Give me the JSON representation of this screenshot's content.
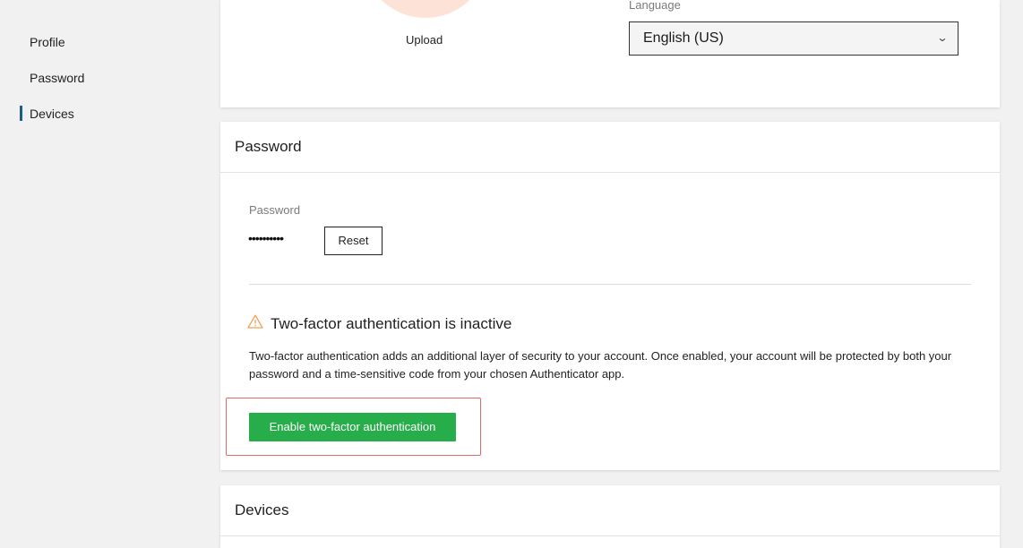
{
  "sidebar": {
    "items": [
      {
        "label": "Profile"
      },
      {
        "label": "Password"
      },
      {
        "label": "Devices"
      }
    ],
    "active": "Devices"
  },
  "profile": {
    "upload_label": "Upload",
    "language_label": "Language",
    "language_value": "English (US)"
  },
  "password_card": {
    "title": "Password",
    "field_label": "Password",
    "masked_value": "••••••••••",
    "reset_label": "Reset",
    "tfa_title": "Two-factor authentication is inactive",
    "tfa_description": "Two-factor authentication adds an additional layer of security to your account. Once enabled, your account will be protected by both your password and a time-sensitive code from your chosen Authenticator app.",
    "enable_label": "Enable two-factor authentication"
  },
  "devices_card": {
    "title": "Devices"
  },
  "icons": {
    "warning": "warning-triangle-icon",
    "dropdown": "chevron-down-icon"
  },
  "colors": {
    "accent": "#1f5d86",
    "success": "#27ae4b",
    "warning": "#f0a257",
    "highlight": "#e26767",
    "avatar": "#fde3d7"
  }
}
